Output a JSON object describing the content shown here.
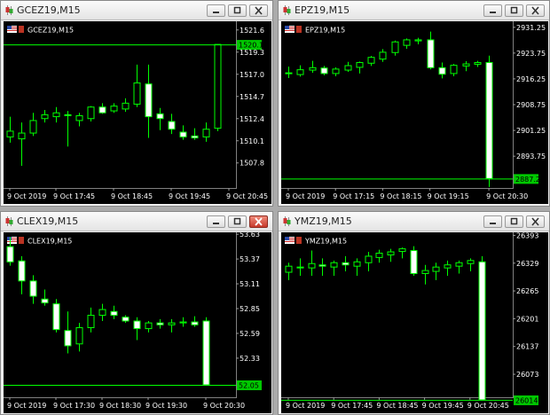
{
  "colors": {
    "background": "#000000",
    "candle": "#00ff00",
    "bull_body": "#000000",
    "bear_body": "#ffffff",
    "text": "#ffffff",
    "price_tag": "#00c800"
  },
  "windows": [
    {
      "title": "GCEZ19,M15",
      "close_active": false,
      "chart_data": {
        "type": "candlestick",
        "label": "GCEZ19,M15",
        "ylim": [
          1505.2,
          1522.5
        ],
        "y_ticks": [
          "1521.6",
          "1519.3",
          "1517.0",
          "1514.7",
          "1512.4",
          "1510.1",
          "1507.8"
        ],
        "y_tick_values": [
          1521.6,
          1519.3,
          1517.0,
          1514.7,
          1512.4,
          1510.1,
          1507.8
        ],
        "x_labels": [
          "9 Oct 2019",
          "9 Oct 17:45",
          "9 Oct 18:45",
          "9 Oct 19:45",
          "9 Oct 20:45"
        ],
        "x_label_candles": [
          0,
          4,
          9,
          14,
          19
        ],
        "current_price": "1520.1",
        "current_price_value": 1520.1,
        "ohlc": [
          [
            1510.5,
            1512.6,
            1509.9,
            1511.1
          ],
          [
            1510.3,
            1512.0,
            1507.5,
            1510.9
          ],
          [
            1510.9,
            1513.0,
            1510.6,
            1512.2
          ],
          [
            1512.4,
            1513.3,
            1512.0,
            1512.8
          ],
          [
            1512.6,
            1513.6,
            1512.0,
            1513.0
          ],
          [
            1512.8,
            1513.2,
            1509.5,
            1512.7
          ],
          [
            1512.2,
            1513.0,
            1511.6,
            1512.7
          ],
          [
            1512.4,
            1513.7,
            1512.1,
            1513.6
          ],
          [
            1513.6,
            1514.0,
            1512.9,
            1513.0
          ],
          [
            1513.2,
            1514.0,
            1513.0,
            1513.7
          ],
          [
            1513.4,
            1514.5,
            1513.1,
            1514.0
          ],
          [
            1513.9,
            1518.0,
            1513.6,
            1516.1
          ],
          [
            1516.0,
            1518.0,
            1510.4,
            1512.6
          ],
          [
            1512.9,
            1513.5,
            1511.2,
            1512.4
          ],
          [
            1512.1,
            1512.9,
            1510.8,
            1511.3
          ],
          [
            1511.0,
            1511.7,
            1510.2,
            1510.5
          ],
          [
            1510.6,
            1511.4,
            1510.2,
            1510.4
          ],
          [
            1510.5,
            1512.0,
            1510.0,
            1511.3
          ],
          [
            1511.4,
            1516.0,
            1511.1,
            1520.1
          ]
        ]
      }
    },
    {
      "title": "EPZ19,M15",
      "close_active": false,
      "chart_data": {
        "type": "candlestick",
        "label": "EPZ19,M15",
        "ylim": [
          2884.5,
          2933.0
        ],
        "y_ticks": [
          "2931.25",
          "2923.75",
          "2916.25",
          "2908.75",
          "2901.25",
          "2893.75"
        ],
        "y_tick_values": [
          2931.25,
          2923.75,
          2916.25,
          2908.75,
          2901.25,
          2893.75
        ],
        "x_labels": [
          "9 Oct 2019",
          "9 Oct 17:15",
          "9 Oct 18:15",
          "9 Oct 19:15",
          "9 Oct 20:30"
        ],
        "x_label_candles": [
          0,
          4,
          8,
          12,
          17
        ],
        "current_price": "2887.25",
        "current_price_value": 2887.25,
        "ohlc": [
          [
            2918.0,
            2919.8,
            2916.5,
            2917.8
          ],
          [
            2917.5,
            2920.2,
            2916.9,
            2918.9
          ],
          [
            2918.8,
            2921.5,
            2918.0,
            2919.5
          ],
          [
            2919.4,
            2920.0,
            2917.3,
            2917.8
          ],
          [
            2917.8,
            2919.6,
            2917.0,
            2919.1
          ],
          [
            2918.8,
            2921.2,
            2918.3,
            2920.1
          ],
          [
            2919.6,
            2921.3,
            2917.8,
            2921.0
          ],
          [
            2920.8,
            2922.9,
            2920.0,
            2922.5
          ],
          [
            2922.0,
            2924.9,
            2921.2,
            2924.0
          ],
          [
            2923.9,
            2927.4,
            2923.0,
            2927.0
          ],
          [
            2926.0,
            2928.0,
            2925.0,
            2927.6
          ],
          [
            2927.3,
            2928.2,
            2926.3,
            2927.6
          ],
          [
            2927.6,
            2930.0,
            2919.0,
            2919.5
          ],
          [
            2919.5,
            2921.0,
            2916.4,
            2917.6
          ],
          [
            2917.8,
            2920.6,
            2917.0,
            2920.2
          ],
          [
            2920.0,
            2921.4,
            2918.5,
            2920.6
          ],
          [
            2920.5,
            2921.5,
            2919.7,
            2921.0
          ],
          [
            2921.0,
            2923.0,
            2884.8,
            2887.25
          ]
        ]
      }
    },
    {
      "title": "CLEX19,M15",
      "close_active": true,
      "chart_data": {
        "type": "candlestick",
        "label": "CLEX19,M15",
        "ylim": [
          51.92,
          53.65
        ],
        "y_ticks": [
          "53.63",
          "53.37",
          "53.11",
          "52.85",
          "52.59",
          "52.33"
        ],
        "y_tick_values": [
          53.63,
          53.37,
          53.11,
          52.85,
          52.59,
          52.33
        ],
        "x_labels": [
          "9 Oct 2019",
          "9 Oct 17:30",
          "9 Oct 18:30",
          "9 Oct 19:30",
          "9 Oct 20:30"
        ],
        "x_label_candles": [
          0,
          4,
          8,
          12,
          17
        ],
        "current_price": "52.05",
        "current_price_value": 52.05,
        "ohlc": [
          [
            53.5,
            53.6,
            53.3,
            53.34
          ],
          [
            53.35,
            53.4,
            53.0,
            53.14
          ],
          [
            53.14,
            53.2,
            52.9,
            52.98
          ],
          [
            52.95,
            53.05,
            52.88,
            52.91
          ],
          [
            52.9,
            52.95,
            52.6,
            52.63
          ],
          [
            52.62,
            52.82,
            52.38,
            52.46
          ],
          [
            52.48,
            52.7,
            52.4,
            52.65
          ],
          [
            52.65,
            52.86,
            52.6,
            52.78
          ],
          [
            52.78,
            52.9,
            52.72,
            52.84
          ],
          [
            52.82,
            52.88,
            52.74,
            52.78
          ],
          [
            52.76,
            52.78,
            52.7,
            52.72
          ],
          [
            52.72,
            52.76,
            52.52,
            52.64
          ],
          [
            52.64,
            52.72,
            52.6,
            52.7
          ],
          [
            52.7,
            52.74,
            52.64,
            52.68
          ],
          [
            52.68,
            52.74,
            52.6,
            52.7
          ],
          [
            52.7,
            52.76,
            52.66,
            52.71
          ],
          [
            52.71,
            52.77,
            52.66,
            52.68
          ],
          [
            52.72,
            52.76,
            52.05,
            52.05
          ]
        ]
      }
    },
    {
      "title": "YMZ19,M15",
      "close_active": false,
      "chart_data": {
        "type": "candlestick",
        "label": "YMZ19,M15",
        "ylim": [
          26020,
          26400
        ],
        "y_ticks": [
          "26393",
          "26329",
          "26265",
          "26201",
          "26137",
          "26073"
        ],
        "y_tick_values": [
          26393,
          26329,
          26265,
          26201,
          26137,
          26073
        ],
        "x_labels": [
          "9 Oct 2019",
          "9 Oct 17:45",
          "9 Oct 18:45",
          "9 Oct 19:45",
          "9 Oct 20:45"
        ],
        "x_label_candles": [
          0,
          4,
          8,
          12,
          16
        ],
        "current_price": "26014",
        "current_price_value": 26014,
        "ohlc": [
          [
            26308,
            26330,
            26290,
            26322
          ],
          [
            26320,
            26340,
            26300,
            26318
          ],
          [
            26318,
            26358,
            26300,
            26328
          ],
          [
            26325,
            26340,
            26300,
            26322
          ],
          [
            26320,
            26335,
            26300,
            26330
          ],
          [
            26330,
            26345,
            26310,
            26325
          ],
          [
            26322,
            26340,
            26300,
            26332
          ],
          [
            26330,
            26355,
            26310,
            26345
          ],
          [
            26342,
            26360,
            26330,
            26352
          ],
          [
            26348,
            26362,
            26332,
            26355
          ],
          [
            26356,
            26365,
            26340,
            26362
          ],
          [
            26358,
            26368,
            26300,
            26305
          ],
          [
            26305,
            26325,
            26280,
            26312
          ],
          [
            26310,
            26330,
            26290,
            26320
          ],
          [
            26318,
            26335,
            26300,
            26325
          ],
          [
            26322,
            26335,
            26305,
            26330
          ],
          [
            26328,
            26340,
            26310,
            26335
          ],
          [
            26332,
            26345,
            26015,
            26014
          ]
        ]
      }
    }
  ]
}
